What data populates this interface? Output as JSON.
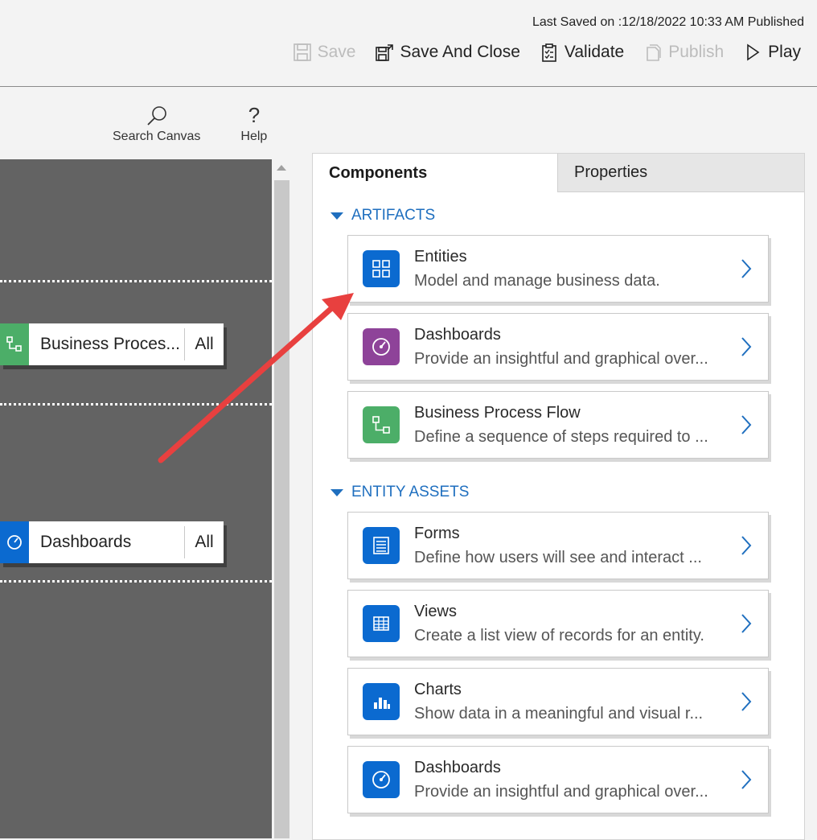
{
  "header": {
    "last_saved": "Last Saved on :12/18/2022 10:33 AM Published",
    "save": "Save",
    "save_and_close": "Save And Close",
    "validate": "Validate",
    "publish": "Publish",
    "play": "Play"
  },
  "canvas_tools": {
    "search": "Search Canvas",
    "help": "Help"
  },
  "canvas": {
    "nodes": [
      {
        "label": "Business Proces...",
        "all": "All",
        "color": "#4cae68",
        "icon": "process-flow-icon"
      },
      {
        "label": "Dashboards",
        "all": "All",
        "color": "#0b6ad0",
        "icon": "dashboard-gauge-icon"
      }
    ]
  },
  "panel": {
    "tabs": [
      "Components",
      "Properties"
    ],
    "artifacts_header": "ARTIFACTS",
    "entity_assets_header": "ENTITY ASSETS",
    "artifacts": [
      {
        "title": "Entities",
        "desc": "Model and manage business data.",
        "color": "#0b6ad0",
        "icon": "entities-grid-icon"
      },
      {
        "title": "Dashboards",
        "desc": "Provide an insightful and graphical over...",
        "color": "#8e4399",
        "icon": "dashboard-gauge-icon"
      },
      {
        "title": "Business Process Flow",
        "desc": "Define a sequence of steps required to ...",
        "color": "#4cae68",
        "icon": "process-flow-icon"
      }
    ],
    "entity_assets": [
      {
        "title": "Forms",
        "desc": "Define how users will see and interact ...",
        "color": "#0b6ad0",
        "icon": "form-icon"
      },
      {
        "title": "Views",
        "desc": "Create a list view of records for an entity.",
        "color": "#0b6ad0",
        "icon": "table-view-icon"
      },
      {
        "title": "Charts",
        "desc": "Show data in a meaningful and visual r...",
        "color": "#0b6ad0",
        "icon": "bar-chart-icon"
      },
      {
        "title": "Dashboards",
        "desc": "Provide an insightful and graphical over...",
        "color": "#0b6ad0",
        "icon": "dashboard-gauge-icon"
      }
    ]
  },
  "colors": {
    "accent": "#1f6fbf",
    "annotation_arrow": "#e8403f"
  }
}
